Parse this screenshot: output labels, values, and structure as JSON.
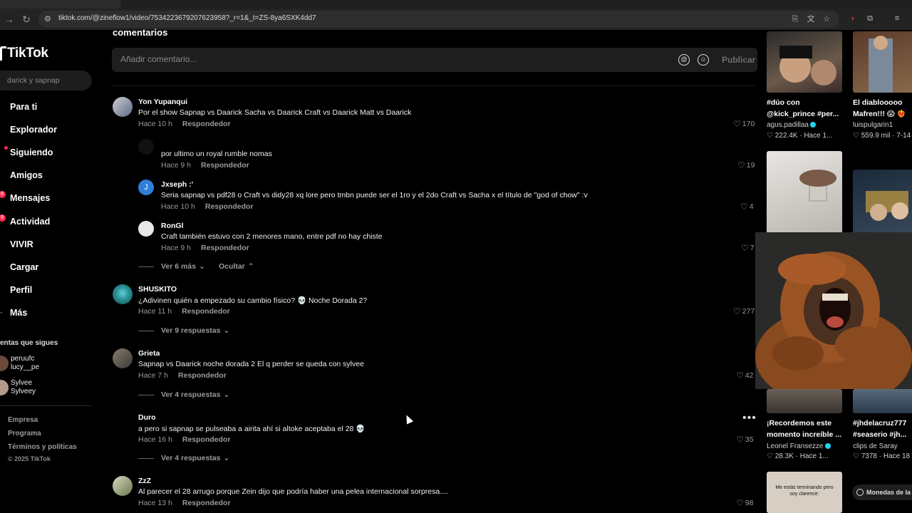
{
  "browser": {
    "url": "tiktok.com/@zineflow1/video/7534223679207623958?_r=1&_t=ZS-8ya6SXK4dd7"
  },
  "sidebar": {
    "logo": "TikTok",
    "search_placeholder": "darick y sapnap",
    "items": [
      {
        "label": "Para ti",
        "icon": "home-icon"
      },
      {
        "label": "Explorador",
        "icon": "compass-icon"
      },
      {
        "label": "Siguiendo",
        "icon": "following-icon"
      },
      {
        "label": "Amigos",
        "icon": "friends-icon"
      },
      {
        "label": "Mensajes",
        "icon": "messages-icon",
        "badge": "8"
      },
      {
        "label": "Actividad",
        "icon": "activity-icon",
        "badge": "9"
      },
      {
        "label": "VIVIR",
        "icon": "live-icon"
      },
      {
        "label": "Cargar",
        "icon": "upload-icon"
      },
      {
        "label": "Perfil",
        "icon": "profile-icon"
      },
      {
        "label": "Más",
        "icon": "more-icon"
      }
    ],
    "following_title": "entas que sigues",
    "following": [
      {
        "line1": "peruufc",
        "line2": "lucy__pe"
      },
      {
        "line1": "Sylvee",
        "line2": "Sylveey"
      }
    ],
    "footer": [
      "Empresa",
      "Programa",
      "Términos y políticas"
    ],
    "copyright": "© 2025 TikTok"
  },
  "comments": {
    "title": "comentarios",
    "input_placeholder": "Añadir comentario...",
    "publish_label": "Publicar",
    "reply_label": "Responder",
    "reply_label_alt": "Respondedor",
    "items": [
      {
        "user": "Yon Yupanqui",
        "text": "Por el show Sapnap vs Daarick Sacha vs Daarick Craft vs Daarick Matt vs Daarick",
        "time": "Hace 10 h",
        "reply": "Respondedor",
        "likes": "170"
      },
      {
        "user": "",
        "text": "por ultimo un royal rumble nomas",
        "time": "Hace 9 h",
        "reply": "Respondedor",
        "likes": "19"
      },
      {
        "user": "Jxseph :'",
        "text": "Seria sapnap vs pdf28 o Craft vs didy28 xq lore pero tmbn puede ser el 1ro y el 2do Craft vs Sacha x el título de \"god of chow\" :v",
        "time": "Hace 10 h",
        "reply": "Respondedor",
        "likes": "4"
      },
      {
        "user": "RonGl",
        "text": "Craft también estuvo con 2 menores mano, entre pdf no hay chiste",
        "time": "Hace 9 h",
        "reply": "Respondedor",
        "likes": "7"
      },
      {
        "user": "SHUSKITO",
        "text": "¿Adivinen quién a empezado su cambio físico? 💀 Noche Dorada 2?",
        "time": "Hace 11 h",
        "reply": "Respondedor",
        "likes": "277"
      },
      {
        "user": "Grieta",
        "text": "Sapnap vs Daarick noche dorada 2 El q perder se queda con sylvee",
        "time": "Hace 7 h",
        "reply": "Respondedor",
        "likes": "42"
      },
      {
        "user": "Duro",
        "text": "a pero si sapnap se pulseaba a airita ahí si altoke aceptaba el 28 💀",
        "time": "Hace 16 h",
        "reply": "Respondedor",
        "likes": "35"
      },
      {
        "user": "ZzZ",
        "text": "Al parecer el 28 arrugo porque Zein dijo que podría haber una pelea internacional sorpresa....",
        "time": "Hace 13 h",
        "reply": "Respondedor",
        "likes": "98"
      }
    ],
    "see_more": "Ver 6 más",
    "hide": "Ocultar",
    "view_9": "Ver 9 respuestas",
    "view_4a": "Ver 4 respuestas",
    "view_4b": "Ver 4 respuestas"
  },
  "videos": [
    {
      "title1": "#dúo con",
      "title2": "@kick_prince #per...",
      "author": "agus.padillaa",
      "stats": "♡ 222.4K · Hace 1..."
    },
    {
      "title1": "El diablooooo",
      "title2": "Mafren!!! 😱 ❤️‍🔥",
      "author": "luispulgarin1",
      "stats": "♡ 559.9 mil · 7-14"
    },
    {
      "title1": "¡Recordemos este",
      "title2": "momento increíble ...",
      "author": "Leonel Fransezze",
      "stats": "♡ 28.3K · Hace 1..."
    },
    {
      "title1": "#jhdelacruz777",
      "title2": "#seaserio #jh...",
      "author": "clips de Saray",
      "stats": "♡ 7378 · Hace 18"
    },
    {
      "caption": "Me estás terminando pero soy clarence:"
    }
  ],
  "coins_label": "Monedas de la l"
}
